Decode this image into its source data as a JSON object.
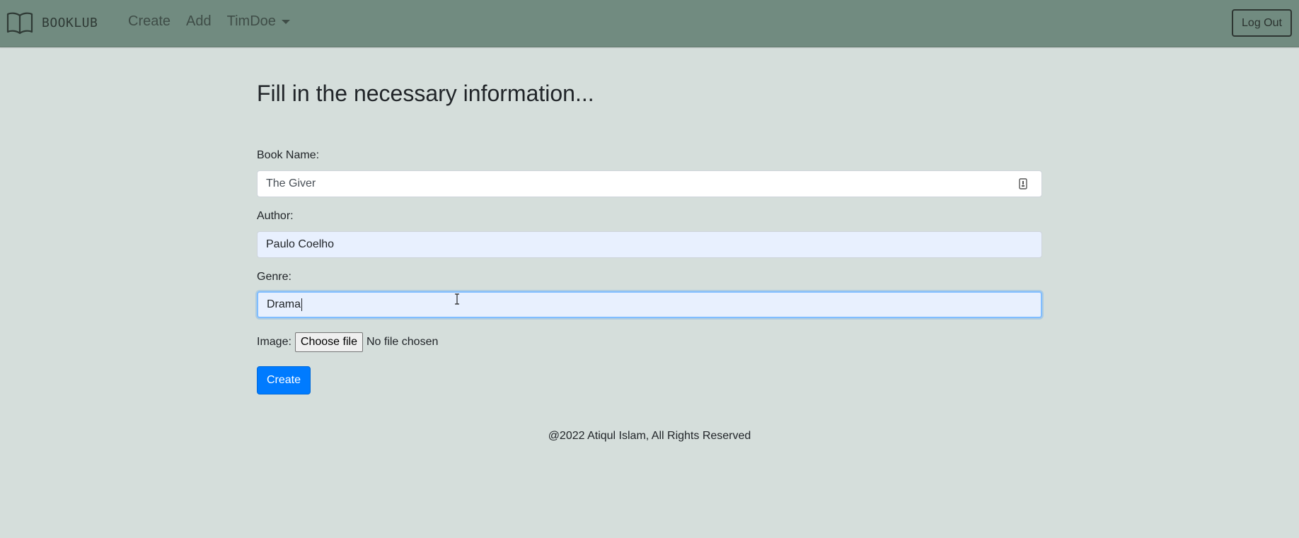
{
  "nav": {
    "brand": "BOOKLUB",
    "brand_icon": "book-icon",
    "links": [
      "Create",
      "Add"
    ],
    "user_menu": "TimDoe",
    "logout": "Log Out"
  },
  "form": {
    "heading": "Fill in the necessary information...",
    "book_name": {
      "label": "Book Name:",
      "value": "The Giver"
    },
    "author": {
      "label": "Author:",
      "value": "Paulo Coelho"
    },
    "genre": {
      "label": "Genre:",
      "value": "Drama"
    },
    "image": {
      "label": "Image:",
      "button": "Choose file",
      "status": "No file chosen"
    },
    "submit": "Create"
  },
  "footer": {
    "text": "@2022 Atiqul Islam, All Rights Reserved"
  },
  "colors": {
    "navbar": "#718b80",
    "page_bg": "#d5dedb",
    "primary": "#007bff",
    "autofill": "#e8f0fe"
  }
}
